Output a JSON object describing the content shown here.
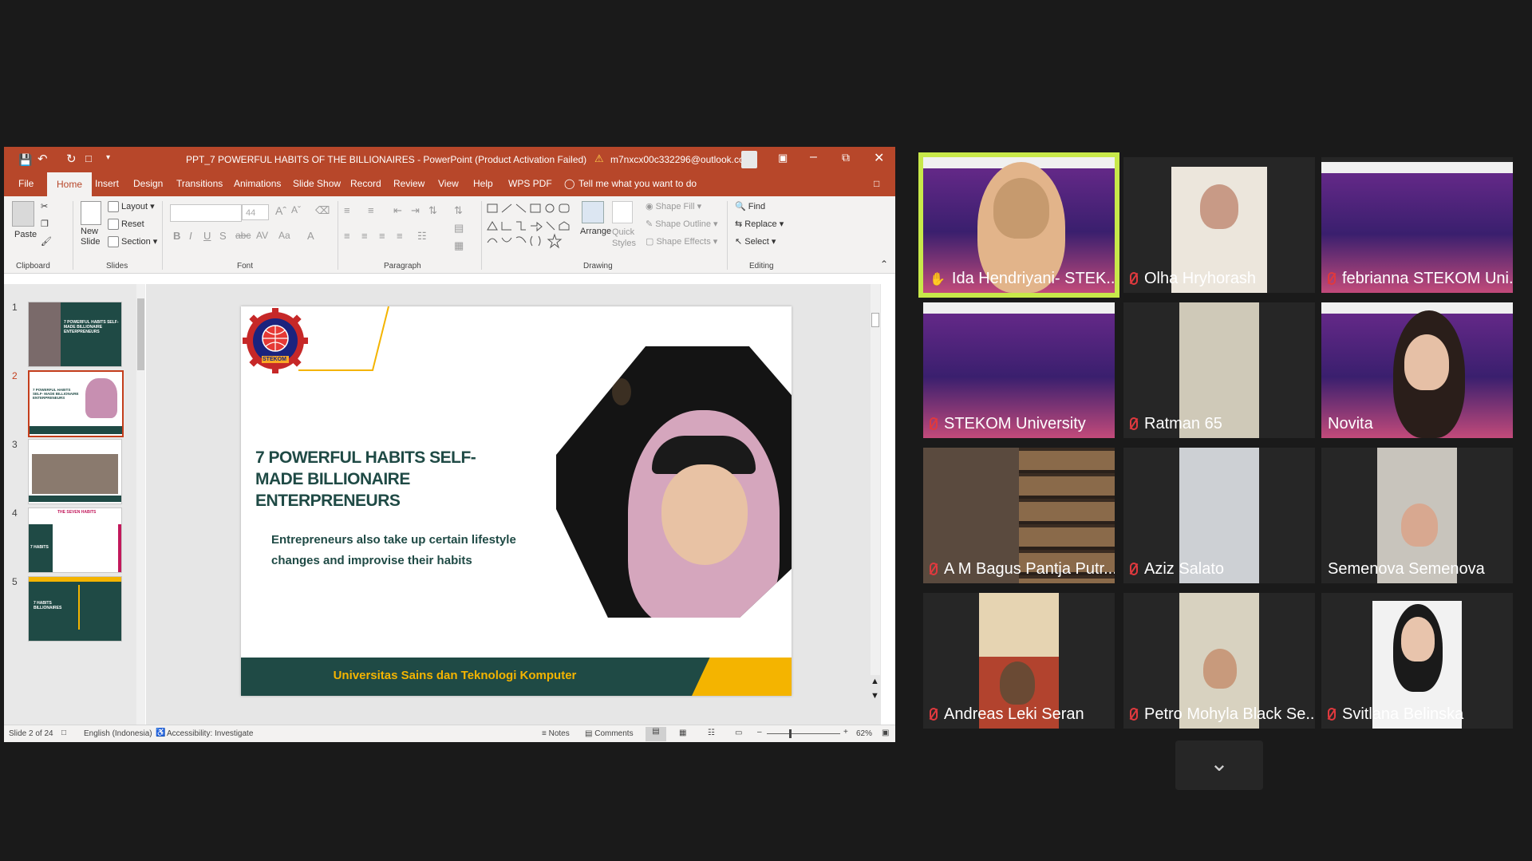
{
  "ppt": {
    "title": "PPT_7 POWERFUL HABITS OF THE BILLIONAIRES  -  PowerPoint (Product Activation Failed)",
    "account": "m7nxcx00c332296@outlook.com",
    "tabs": [
      "File",
      "Home",
      "Insert",
      "Design",
      "Transitions",
      "Animations",
      "Slide Show",
      "Record",
      "Review",
      "View",
      "Help",
      "WPS PDF"
    ],
    "active_tab": "Home",
    "tell_me": "Tell me what you want to do",
    "ribbon": {
      "paste": "Paste",
      "layout": "Layout",
      "reset": "Reset",
      "section": "Section",
      "new_slide": "New Slide",
      "font_size": "44",
      "arrange": "Arrange",
      "quick_styles": "Quick Styles",
      "shape_fill": "Shape Fill",
      "shape_outline": "Shape Outline",
      "shape_effects": "Shape Effects",
      "find": "Find",
      "replace": "Replace",
      "select": "Select",
      "groups": {
        "clipboard": "Clipboard",
        "slides": "Slides",
        "font": "Font",
        "paragraph": "Paragraph",
        "drawing": "Drawing",
        "editing": "Editing"
      }
    },
    "thumbnails": [
      "1",
      "2",
      "3",
      "4",
      "5"
    ],
    "selected_thumb": "2",
    "thumb_texts": {
      "t1": "7 POWERFUL HABITS SELF-MADE BILLIONAIRE ENTERPRENEURS",
      "t2": "7 POWERFUL HABITS SELF- MADE BILLIONAIRE ENTERPRENEURS",
      "t4": "THE SEVEN HABITS",
      "t4b": "7 HABITS",
      "t5": "7 HABITS BILLIONAIRES"
    },
    "slide": {
      "logo_text": "STEKOM",
      "heading": "7 POWERFUL HABITS SELF- MADE BILLIONAIRE ENTERPRENEURS",
      "body": "Entrepreneurs also take up certain lifestyle changes and improvise their habits",
      "footer": "Universitas Sains dan Teknologi Komputer"
    },
    "status": {
      "slide_of": "Slide 2 of 24",
      "language": "English (Indonesia)",
      "accessibility": "Accessibility: Investigate",
      "notes": "Notes",
      "comments": "Comments",
      "zoom": "62%"
    }
  },
  "participants": [
    {
      "name": "Ida Hendriyani-  STEK...",
      "muted": false,
      "speaking": true
    },
    {
      "name": "Olha Hryhorash",
      "muted": true
    },
    {
      "name": "febrianna STEKOM Uni...",
      "muted": true
    },
    {
      "name": "STEKOM University",
      "muted": true
    },
    {
      "name": "Ratman 65",
      "muted": true
    },
    {
      "name": "Novita",
      "muted": false
    },
    {
      "name": "A M Bagus Pantja Putr...",
      "muted": true
    },
    {
      "name": "Aziz Salato",
      "muted": true
    },
    {
      "name": "Semenova Semenova",
      "muted": false
    },
    {
      "name": "Andreas Leki Seran",
      "muted": true
    },
    {
      "name": "Petro Mohyla Black Se...",
      "muted": true
    },
    {
      "name": "Svitlana Belinska",
      "muted": true
    }
  ],
  "colors": {
    "ppt_accent": "#b7472a",
    "speaker_border": "#c8e84a",
    "slide_dark": "#1f4a45",
    "slide_yellow": "#f4b400",
    "muted_red": "#e0393e"
  }
}
